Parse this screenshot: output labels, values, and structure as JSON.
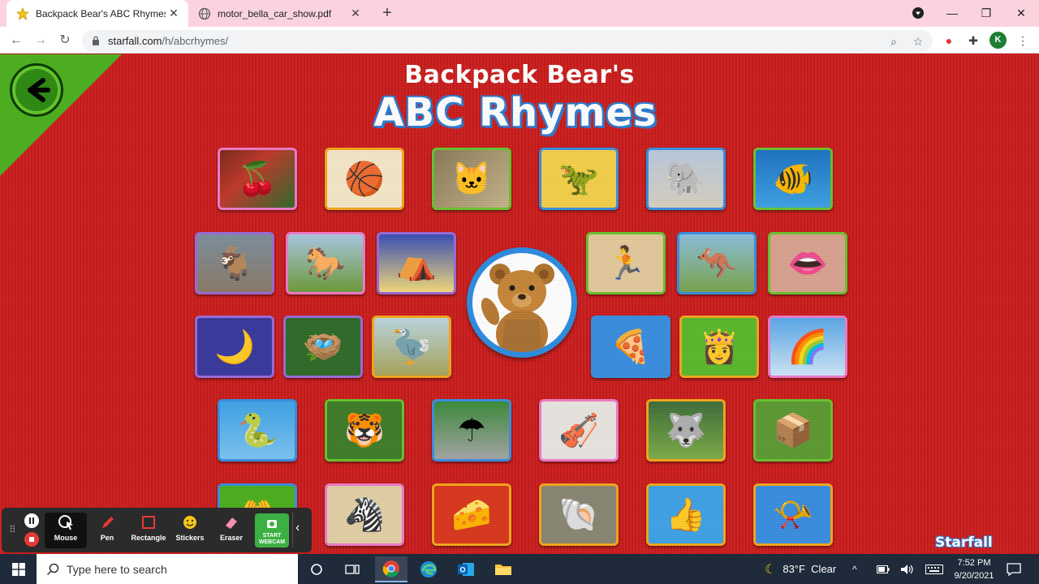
{
  "browser": {
    "tabs": [
      {
        "title": "Backpack Bear's ABC Rhymes!",
        "active": true
      },
      {
        "title": "motor_bella_car_show.pdf",
        "active": false
      }
    ],
    "url_host": "starfall.com",
    "url_path": "/h/abcrhymes/",
    "profile_initial": "K"
  },
  "page": {
    "heading_line1": "Backpack Bear's",
    "heading_line2": "ABC Rhymes",
    "logo": "Starfall",
    "tiles": [
      {
        "name": "apples",
        "icon": "apple-icon",
        "glyph": "🍒"
      },
      {
        "name": "ball",
        "icon": "basketball-icon",
        "glyph": "🏀"
      },
      {
        "name": "cat",
        "icon": "cat-icon",
        "glyph": "🐱"
      },
      {
        "name": "dinosaur",
        "icon": "dinosaur-icon",
        "glyph": "🦖"
      },
      {
        "name": "elephant",
        "icon": "elephant-icon",
        "glyph": "🐘"
      },
      {
        "name": "fish",
        "icon": "fish-icon",
        "glyph": "🐠"
      },
      {
        "name": "goat",
        "icon": "goat-icon",
        "glyph": "🐐"
      },
      {
        "name": "horse",
        "icon": "horse-icon",
        "glyph": "🐎"
      },
      {
        "name": "igloo",
        "icon": "igloo-icon",
        "glyph": "⛺"
      },
      {
        "name": "jump-rope",
        "icon": "jump-rope-icon",
        "glyph": "🏃"
      },
      {
        "name": "kangaroo",
        "icon": "kangaroo-icon",
        "glyph": "🦘"
      },
      {
        "name": "lips",
        "icon": "lips-icon",
        "glyph": "👄"
      },
      {
        "name": "moon",
        "icon": "moon-icon",
        "glyph": "🌙"
      },
      {
        "name": "nest",
        "icon": "nest-icon",
        "glyph": "🪺"
      },
      {
        "name": "ostrich",
        "icon": "ostrich-icon",
        "glyph": "🦤"
      },
      {
        "name": "pizza",
        "icon": "pizza-icon",
        "glyph": "🍕"
      },
      {
        "name": "queen",
        "icon": "queen-card-icon",
        "glyph": "👸"
      },
      {
        "name": "rainbow",
        "icon": "rainbow-icon",
        "glyph": "🌈"
      },
      {
        "name": "snake",
        "icon": "snake-icon",
        "glyph": "🐍"
      },
      {
        "name": "tiger",
        "icon": "tiger-icon",
        "glyph": "🐯"
      },
      {
        "name": "umbrella",
        "icon": "umbrella-icon",
        "glyph": "☂"
      },
      {
        "name": "violin",
        "icon": "violin-icon",
        "glyph": "🎻"
      },
      {
        "name": "wolf",
        "icon": "wolf-icon",
        "glyph": "🐺"
      },
      {
        "name": "box",
        "icon": "box-icon",
        "glyph": "📦"
      },
      {
        "name": "hands",
        "icon": "hands-icon",
        "glyph": "🤲"
      },
      {
        "name": "zebra",
        "icon": "zebra-icon",
        "glyph": "🦓"
      },
      {
        "name": "cheese",
        "icon": "cheese-icon",
        "glyph": "🧀"
      },
      {
        "name": "shell",
        "icon": "shell-icon",
        "glyph": "🐚"
      },
      {
        "name": "thumb",
        "icon": "thumb-icon",
        "glyph": "👍"
      },
      {
        "name": "whistle",
        "icon": "whistle-icon",
        "glyph": "📯"
      }
    ]
  },
  "recorder": {
    "tools": [
      {
        "label": "Mouse",
        "icon": "mouse-icon"
      },
      {
        "label": "Pen",
        "icon": "pen-icon"
      },
      {
        "label": "Rectangle",
        "icon": "rectangle-icon"
      },
      {
        "label": "Stickers",
        "icon": "sticker-icon"
      },
      {
        "label": "Eraser",
        "icon": "eraser-icon"
      }
    ],
    "webcam_line1": "START",
    "webcam_line2": "WEBCAM"
  },
  "taskbar": {
    "search_placeholder": "Type here to search",
    "weather": "83°F  Clear",
    "time": "7:52 PM",
    "date": "9/20/2021"
  },
  "colors": {
    "page_red": "#c91f1f",
    "corner_green": "#4caf1f",
    "title_blue": "#2e7bd0",
    "tab_bar_pink": "#fbd3df",
    "taskbar": "#1f2a3a"
  }
}
